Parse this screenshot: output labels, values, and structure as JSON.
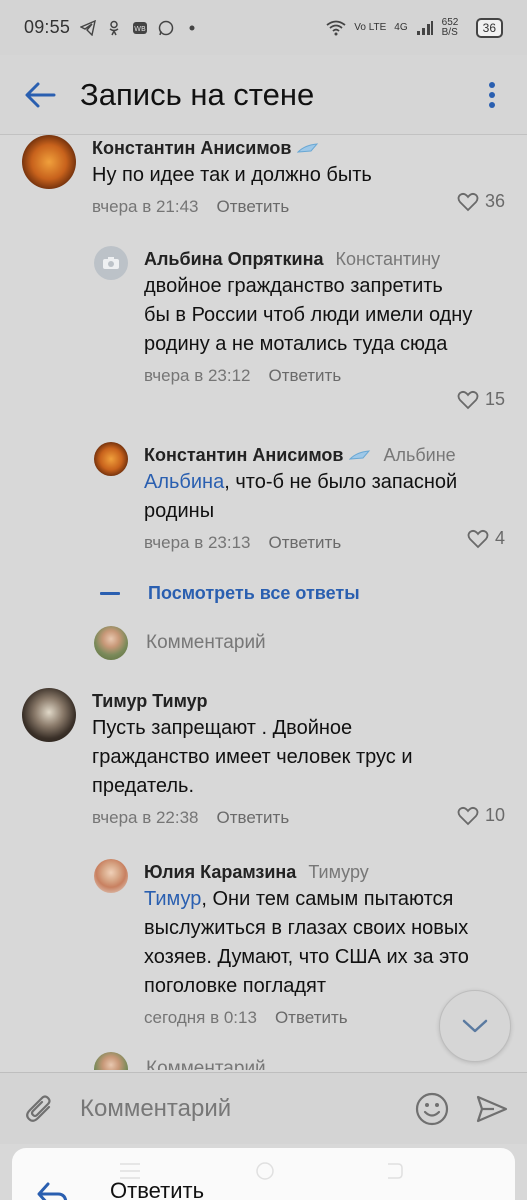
{
  "status_bar": {
    "time": "09:55",
    "network": "Vo LTE",
    "signal": "4G",
    "speed": "652 B/S",
    "battery": "36"
  },
  "header": {
    "title": "Запись на стене"
  },
  "comments": [
    {
      "author": "Константин Анисимов",
      "reply_to": "",
      "text": "Ну по идее так и должно быть",
      "time": "вчера в 21:43",
      "reply_label": "Ответить",
      "likes": "36"
    },
    {
      "author": "Альбина Опряткина",
      "reply_to": "Константину",
      "text": "двойное гражданство запретить бы в России чтоб люди имели одну родину а не мотались туда сюда",
      "time": "вчера в 23:12",
      "reply_label": "Ответить",
      "likes": "15"
    },
    {
      "author": "Константин Анисимов",
      "reply_to": "Альбине",
      "mention": "Альбина",
      "text": ", что-б не было запасной родины",
      "time": "вчера в 23:13",
      "reply_label": "Ответить",
      "likes": "4"
    },
    {
      "author": "Тимур Тимур",
      "reply_to": "",
      "text": "Пусть запрещают . Двойное гражданство имеет  человек трус и предатель.",
      "time": "вчера в 22:38",
      "reply_label": "Ответить",
      "likes": "10"
    },
    {
      "author": "Юлия Карамзина",
      "reply_to": "Тимуру",
      "mention": "Тимур",
      "text": ", Они тем самым пытаются выслужиться в глазах своих новых хозяев. Думают, что США их за это поголовке погладят",
      "time": "сегодня в 0:13",
      "reply_label": "Ответить",
      "likes": ""
    }
  ],
  "show_all_replies": "Посмотреть все ответы",
  "reply_prompt": "Комментарий",
  "input": {
    "placeholder": "Комментарий"
  },
  "sheet": {
    "label": "Ответить"
  },
  "colors": {
    "accent": "#2a5fb0",
    "background": "#d8d8d8"
  }
}
